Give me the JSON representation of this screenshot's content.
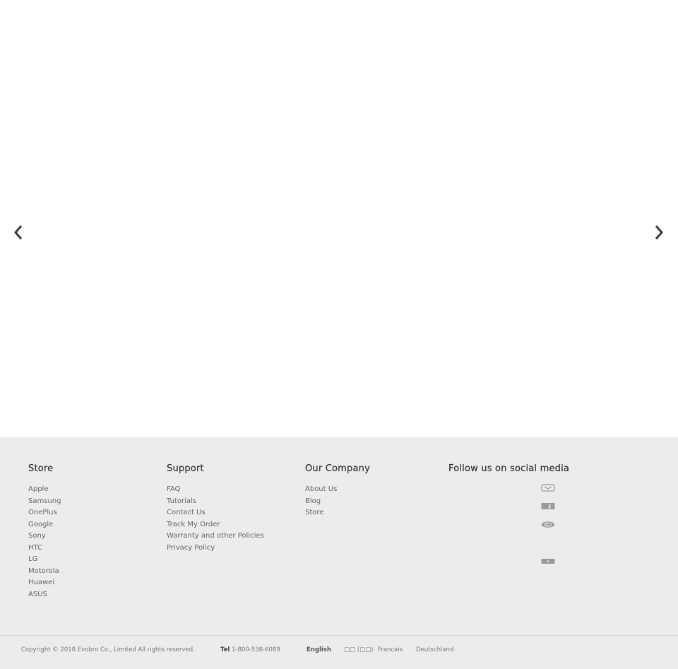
{
  "slider": {
    "prev_icon": "chevron-left-icon",
    "next_icon": "chevron-right-icon"
  },
  "footer": {
    "columns": [
      {
        "title": "Store",
        "links": [
          "Apple",
          "Samsung",
          "OnePlus",
          "Google",
          "Sony",
          "HTC",
          "LG",
          "Motorola",
          "Huawei",
          "ASUS"
        ]
      },
      {
        "title": "Support",
        "links": [
          "FAQ",
          "Tutorials",
          "Contact Us",
          "Track My Order",
          "Warranty and other Policies",
          "Privacy Policy"
        ]
      },
      {
        "title": "Our Company",
        "links": [
          "About Us",
          "Blog",
          "Store"
        ]
      }
    ],
    "social": {
      "title": "Follow us on social media",
      "icons": [
        "email-icon",
        "facebook-icon",
        "weibo-icon",
        "youtube-icon"
      ]
    },
    "bottom": {
      "copyright": "Copyright © 2018 Evobro Co., Limited All rights reserved.",
      "tel_label": "Tel",
      "tel_number": "1-800-538-6089",
      "languages": [
        "English",
        "□□ (□□)",
        "Francais",
        "Deutschland"
      ],
      "active_language": "English"
    }
  },
  "colors": {
    "footer_bg": "#ececec",
    "hero_bg": "#ffffff",
    "heading": "#333333",
    "link": "#666666",
    "icon": "#999999"
  }
}
